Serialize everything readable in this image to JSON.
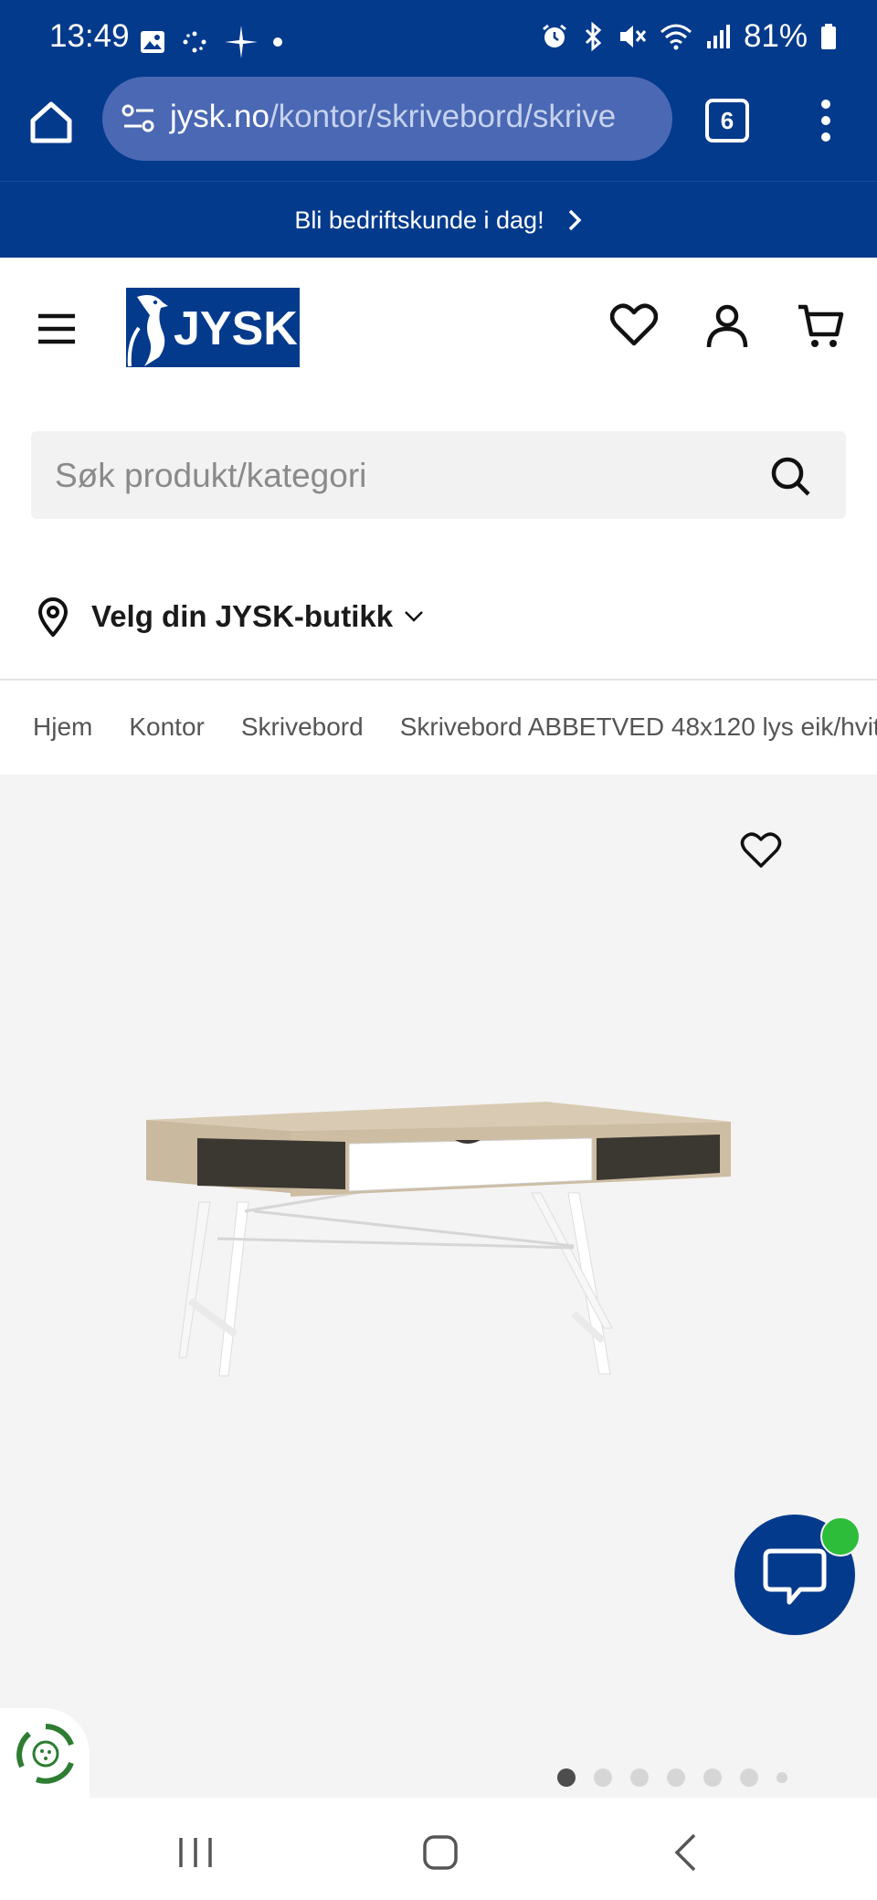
{
  "status_bar": {
    "time": "13:49",
    "battery": "81%"
  },
  "browser": {
    "url_domain": "jysk.no",
    "url_path": "/kontor/skrivebord/skrive",
    "tab_count": "6"
  },
  "promo": {
    "text": "Bli bedriftskunde i dag!"
  },
  "header": {
    "logo_text": "JYSK"
  },
  "search": {
    "placeholder": "Søk produkt/kategori"
  },
  "store": {
    "label": "Velg din JYSK-butikk"
  },
  "breadcrumb": {
    "items": [
      "Hjem",
      "Kontor",
      "Skrivebord",
      "Skrivebord ABBETVED 48x120 lys eik/hvit"
    ]
  },
  "gallery": {
    "image_count": 7,
    "active_index": 0
  },
  "colors": {
    "brand_blue": "#033a8c",
    "chat_online": "#2dbd3a",
    "eco_green": "#2e7d32"
  }
}
